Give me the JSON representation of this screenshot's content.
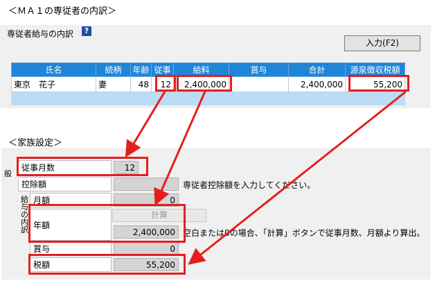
{
  "section1_title": "＜ＭＡ１の専従者の内訳＞",
  "top_panel": {
    "heading": "専従者給与の内訳",
    "help_icon": "?",
    "input_button": "入力(F2)",
    "columns": [
      "氏名",
      "続柄",
      "年齢",
      "従事",
      "給料",
      "賞与",
      "合計",
      "源泉徴収税額"
    ],
    "row": {
      "name": "東京　花子",
      "relation": "妻",
      "age": "48",
      "months": "12",
      "salary": "2,400,000",
      "bonus": "",
      "total": "2,400,000",
      "tax": "55,200"
    }
  },
  "section2_title": "＜家族設定＞",
  "bottom_panel": {
    "side_label_ippan": "般",
    "side_label_kyuyo": "給与の内訳",
    "months_label": "従事月数",
    "months_value": "12",
    "deduction_label": "控除額",
    "deduction_note": "専従者控除額を入力してください。",
    "monthly_label": "月額",
    "monthly_value": "0",
    "annual_label": "年額",
    "calc_button": "計算",
    "annual_value": "2,400,000",
    "annual_note": "空白または0の場合、「計算」ボタンで従事月数、月額より算出。",
    "bonus_label": "賞与",
    "bonus_value": "0",
    "tax_label": "税額",
    "tax_value": "55,200"
  },
  "colors": {
    "highlight": "#e41e1e",
    "header_blue": "#1f85d8"
  }
}
